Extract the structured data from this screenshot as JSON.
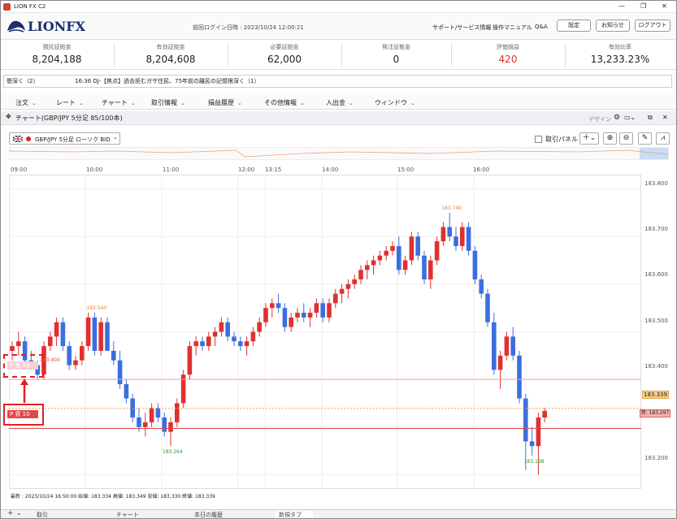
{
  "window": {
    "title": "LION FX C2",
    "min": "—",
    "max": "❐",
    "close": "✕"
  },
  "header": {
    "logo": "LIONFX",
    "login_label": "前回ログイン日時 : 2023/10/24 12:00:21",
    "links": [
      "サポート/サービス情報",
      "操作マニュアル",
      "Q&A"
    ],
    "buttons": [
      "設定",
      "お知らせ",
      "ログアウト"
    ]
  },
  "account": [
    {
      "label": "預託証拠金",
      "value": "8,204,188"
    },
    {
      "label": "有効証拠金",
      "value": "8,204,608"
    },
    {
      "label": "必要証拠金",
      "value": "62,000"
    },
    {
      "label": "発注証拠金",
      "value": "0"
    },
    {
      "label": "評価損益",
      "value": "420",
      "color": "#e03030"
    },
    {
      "label": "有効比率",
      "value": "13,233.23%"
    }
  ],
  "news": {
    "prefix": "懸深く（2）",
    "text": "16:36  DJ-【焦点】過去拒むガザ住民、75年前の離民の記憶根深く（1）"
  },
  "menu": [
    "注文",
    "レート",
    "チャート",
    "取引情報",
    "損益履歴",
    "その他情報",
    "入出金",
    "ウィンドウ"
  ],
  "chart_window": {
    "title": "チャート(GBP/JPY 5分足 85/100本)",
    "design": "デザイン"
  },
  "toolbar": {
    "symbol": "GBP/JPY 5分足 ローソク BID",
    "panel": "取引パネル"
  },
  "chart_data": {
    "type": "candlestick",
    "symbol": "GBP/JPY",
    "timeframe": "5分足",
    "side": "BID",
    "x_ticks": [
      "09:00",
      "10:00",
      "11:00",
      "12:00",
      "13:15",
      "14:00",
      "15:00",
      "16:00"
    ],
    "y_ticks": [
      "183.800",
      "183.700",
      "183.600",
      "183.500",
      "183.400",
      "183.300",
      "183.200"
    ],
    "ylim": [
      183.17,
      183.83
    ],
    "candles": [
      [
        183.46,
        183.48,
        183.44,
        183.47
      ],
      [
        183.47,
        183.5,
        183.45,
        183.48
      ],
      [
        183.48,
        183.49,
        183.43,
        183.44
      ],
      [
        183.44,
        183.46,
        183.42,
        183.43
      ],
      [
        183.43,
        183.44,
        183.4,
        183.41
      ],
      [
        183.41,
        183.48,
        183.4,
        183.47
      ],
      [
        183.47,
        183.5,
        183.46,
        183.49
      ],
      [
        183.49,
        183.53,
        183.47,
        183.52
      ],
      [
        183.52,
        183.53,
        183.46,
        183.47
      ],
      [
        183.47,
        183.48,
        183.42,
        183.43
      ],
      [
        183.43,
        183.45,
        183.42,
        183.44
      ],
      [
        183.44,
        183.48,
        183.43,
        183.47
      ],
      [
        183.47,
        183.54,
        183.46,
        183.53
      ],
      [
        183.53,
        183.54,
        183.45,
        183.46
      ],
      [
        183.46,
        183.53,
        183.45,
        183.52
      ],
      [
        183.52,
        183.53,
        183.46,
        183.46
      ],
      [
        183.46,
        183.48,
        183.43,
        183.44
      ],
      [
        183.44,
        183.46,
        183.38,
        183.39
      ],
      [
        183.39,
        183.4,
        183.35,
        183.36
      ],
      [
        183.36,
        183.37,
        183.31,
        183.32
      ],
      [
        183.32,
        183.34,
        183.29,
        183.3
      ],
      [
        183.3,
        183.33,
        183.28,
        183.31
      ],
      [
        183.31,
        183.35,
        183.3,
        183.34
      ],
      [
        183.34,
        183.35,
        183.31,
        183.32
      ],
      [
        183.32,
        183.33,
        183.28,
        183.29
      ],
      [
        183.29,
        183.32,
        183.26,
        183.31
      ],
      [
        183.31,
        183.36,
        183.3,
        183.35
      ],
      [
        183.35,
        183.42,
        183.34,
        183.41
      ],
      [
        183.41,
        183.48,
        183.4,
        183.47
      ],
      [
        183.47,
        183.49,
        183.45,
        183.48
      ],
      [
        183.48,
        183.49,
        183.46,
        183.47
      ],
      [
        183.47,
        183.5,
        183.46,
        183.49
      ],
      [
        183.49,
        183.51,
        183.47,
        183.5
      ],
      [
        183.5,
        183.53,
        183.49,
        183.52
      ],
      [
        183.52,
        183.53,
        183.48,
        183.49
      ],
      [
        183.49,
        183.5,
        183.47,
        183.48
      ],
      [
        183.48,
        183.49,
        183.46,
        183.47
      ],
      [
        183.47,
        183.49,
        183.45,
        183.48
      ],
      [
        183.48,
        183.51,
        183.47,
        183.5
      ],
      [
        183.5,
        183.53,
        183.49,
        183.52
      ],
      [
        183.52,
        183.56,
        183.51,
        183.55
      ],
      [
        183.55,
        183.57,
        183.53,
        183.56
      ],
      [
        183.56,
        183.58,
        183.54,
        183.55
      ],
      [
        183.55,
        183.56,
        183.5,
        183.51
      ],
      [
        183.51,
        183.54,
        183.5,
        183.53
      ],
      [
        183.53,
        183.55,
        183.52,
        183.54
      ],
      [
        183.54,
        183.56,
        183.52,
        183.53
      ],
      [
        183.53,
        183.55,
        183.51,
        183.54
      ],
      [
        183.54,
        183.57,
        183.53,
        183.56
      ],
      [
        183.56,
        183.57,
        183.52,
        183.53
      ],
      [
        183.53,
        183.57,
        183.52,
        183.56
      ],
      [
        183.56,
        183.59,
        183.55,
        183.58
      ],
      [
        183.58,
        183.6,
        183.56,
        183.59
      ],
      [
        183.59,
        183.61,
        183.57,
        183.6
      ],
      [
        183.6,
        183.62,
        183.59,
        183.61
      ],
      [
        183.61,
        183.64,
        183.6,
        183.63
      ],
      [
        183.63,
        183.65,
        183.61,
        183.64
      ],
      [
        183.64,
        183.66,
        183.62,
        183.65
      ],
      [
        183.65,
        183.67,
        183.64,
        183.66
      ],
      [
        183.66,
        183.68,
        183.65,
        183.67
      ],
      [
        183.67,
        183.69,
        183.66,
        183.68
      ],
      [
        183.68,
        183.7,
        183.62,
        183.63
      ],
      [
        183.63,
        183.66,
        183.62,
        183.65
      ],
      [
        183.65,
        183.71,
        183.64,
        183.7
      ],
      [
        183.7,
        183.71,
        183.65,
        183.66
      ],
      [
        183.66,
        183.67,
        183.6,
        183.61
      ],
      [
        183.61,
        183.66,
        183.59,
        183.65
      ],
      [
        183.65,
        183.7,
        183.64,
        183.69
      ],
      [
        183.69,
        183.73,
        183.68,
        183.72
      ],
      [
        183.72,
        183.75,
        183.69,
        183.7
      ],
      [
        183.7,
        183.72,
        183.67,
        183.68
      ],
      [
        183.68,
        183.73,
        183.67,
        183.72
      ],
      [
        183.72,
        183.73,
        183.66,
        183.67
      ],
      [
        183.67,
        183.68,
        183.6,
        183.61
      ],
      [
        183.61,
        183.62,
        183.57,
        183.58
      ],
      [
        183.58,
        183.59,
        183.51,
        183.52
      ],
      [
        183.52,
        183.54,
        183.41,
        183.42
      ],
      [
        183.42,
        183.46,
        183.38,
        183.45
      ],
      [
        183.45,
        183.5,
        183.44,
        183.49
      ],
      [
        183.49,
        183.51,
        183.44,
        183.45
      ],
      [
        183.45,
        183.46,
        183.35,
        183.36
      ],
      [
        183.36,
        183.37,
        183.21,
        183.27
      ],
      [
        183.27,
        183.3,
        183.24,
        183.26
      ],
      [
        183.26,
        183.33,
        183.2,
        183.32
      ],
      [
        183.32,
        183.34,
        183.31,
        183.334
      ]
    ],
    "current_line": 183.339,
    "position_line": 183.297,
    "order_line": 183.4,
    "high_labels": [
      {
        "price": "183.749",
        "index": 69
      },
      {
        "price": "183.540",
        "index": 13
      }
    ],
    "low_labels": [
      {
        "price": "183.264",
        "index": 25
      },
      {
        "price": "183.198",
        "index": 82
      }
    ],
    "up_color": "#e03030",
    "down_color": "#3a6fe0"
  },
  "price_tags": {
    "current": "183.339",
    "position": "買: 183.297",
    "order_label": "P 買 10",
    "order_price": "183.400",
    "order_ghost": "P 買 10"
  },
  "status": "最新 : 2023/10/24 16:50:00 始値: 183.334 高値: 183.349 安値: 183.330 終値: 183.339",
  "bottom_tabs": [
    "取引",
    "チャート",
    "本日の履歴",
    "新規タブ"
  ]
}
